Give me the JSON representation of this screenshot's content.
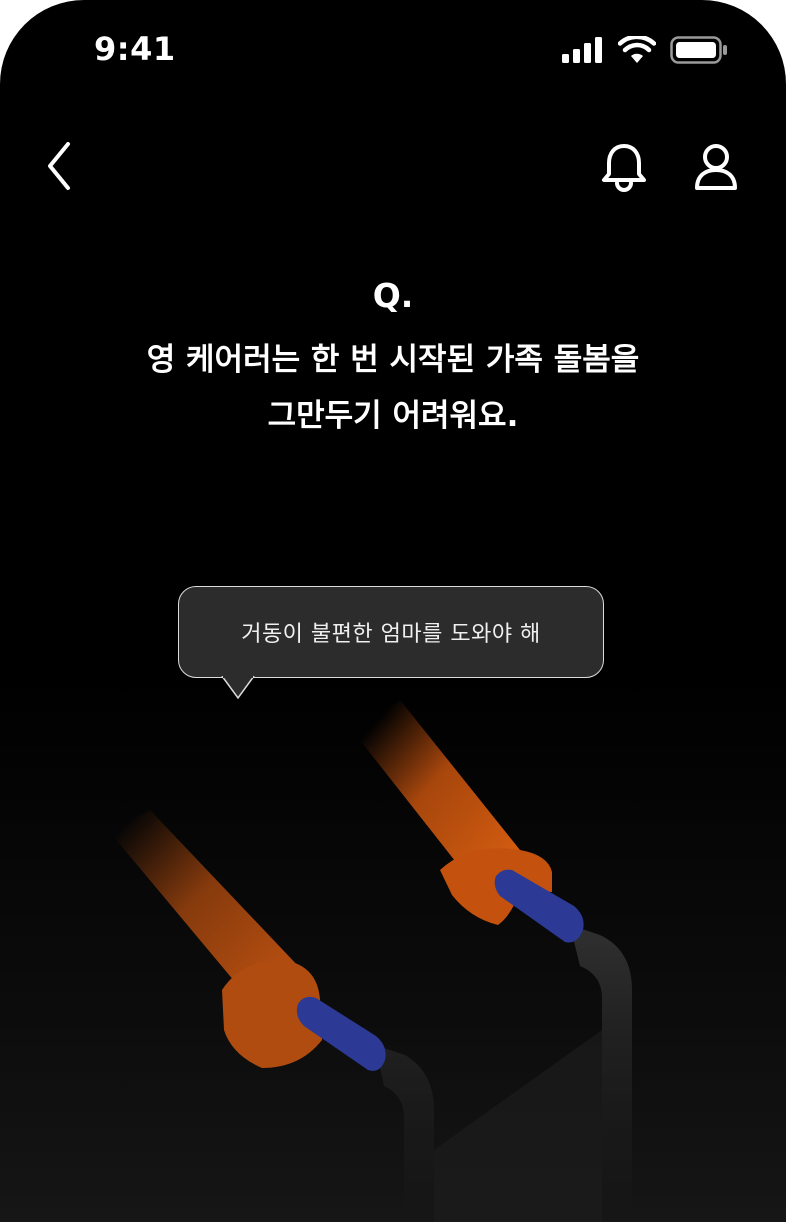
{
  "status_bar": {
    "time": "9:41"
  },
  "nav": {
    "icons": [
      "chevron-left-icon",
      "bell-icon",
      "person-icon"
    ]
  },
  "question": {
    "label": "Q.",
    "line1": "영 케어러는 한 번 시작된 가족 돌봄을",
    "line2": "그만두기 어려워요."
  },
  "bubble": {
    "text": "거동이 불편한 엄마를 도와야 해"
  },
  "colors": {
    "background": "#000000",
    "bubble_fill": "#2c2c2c",
    "hand": "#c4520e",
    "grip": "#2c3a96",
    "walker": "#2a2a2a"
  }
}
